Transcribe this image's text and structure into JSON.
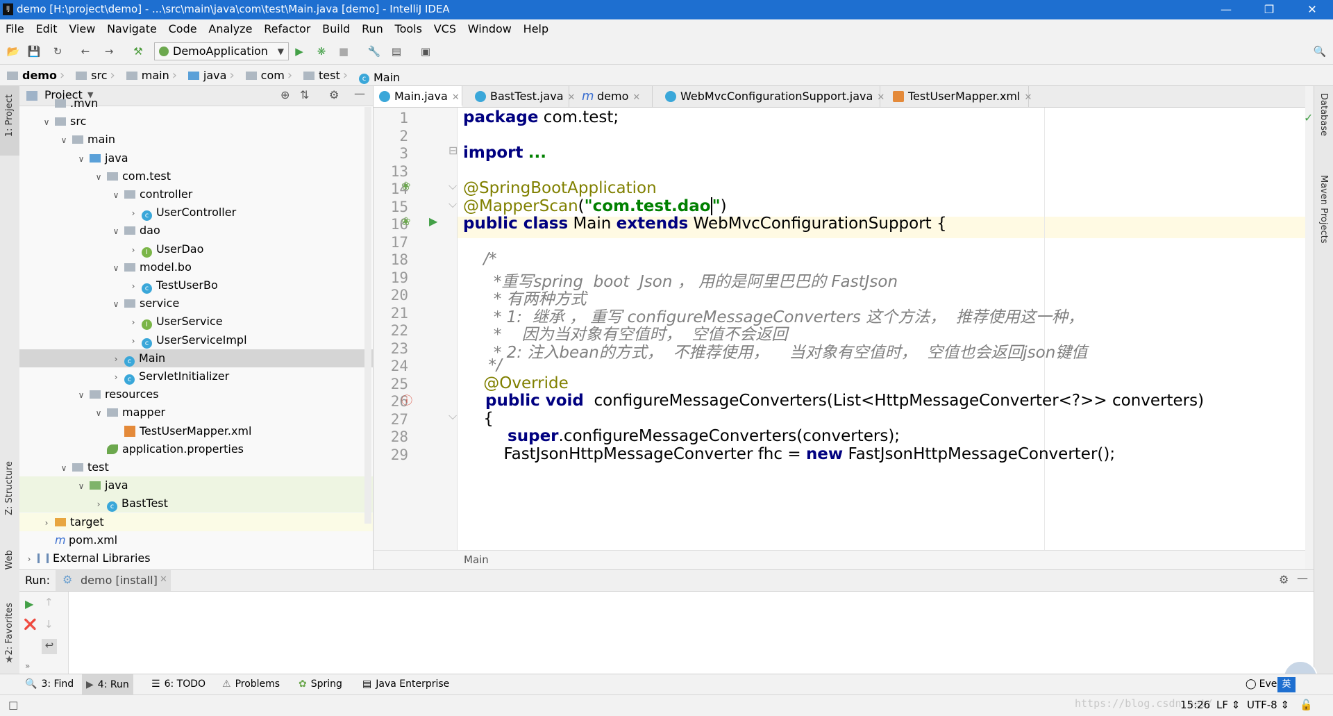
{
  "window": {
    "title": "demo [H:\\project\\demo] - ...\\src\\main\\java\\com\\test\\Main.java [demo] - IntelliJ IDEA",
    "app_icon": "IJ"
  },
  "menu": [
    "File",
    "Edit",
    "View",
    "Navigate",
    "Code",
    "Analyze",
    "Refactor",
    "Build",
    "Run",
    "Tools",
    "VCS",
    "Window",
    "Help"
  ],
  "toolbar": {
    "run_config": "DemoApplication"
  },
  "breadcrumb": [
    "demo",
    "src",
    "main",
    "java",
    "com",
    "test",
    "Main"
  ],
  "left_stripe": {
    "project": "1: Project",
    "structure": "Z: Structure",
    "web": "Web",
    "favorites": "2: Favorites"
  },
  "right_stripe": {
    "database": "Database",
    "maven": "Maven Projects"
  },
  "project_panel": {
    "title": "Project",
    "tree": [
      {
        "label": ".mvn",
        "indent": 1,
        "icon": "folder",
        "arrow": ""
      },
      {
        "label": "src",
        "indent": 1,
        "icon": "folder",
        "arrow": "down"
      },
      {
        "label": "main",
        "indent": 2,
        "icon": "folder",
        "arrow": "down"
      },
      {
        "label": "java",
        "indent": 3,
        "icon": "folder-blue",
        "arrow": "down"
      },
      {
        "label": "com.test",
        "indent": 4,
        "icon": "folder",
        "arrow": "down"
      },
      {
        "label": "controller",
        "indent": 5,
        "icon": "folder",
        "arrow": "down"
      },
      {
        "label": "UserController",
        "indent": 6,
        "icon": "class",
        "arrow": "right"
      },
      {
        "label": "dao",
        "indent": 5,
        "icon": "folder",
        "arrow": "down"
      },
      {
        "label": "UserDao",
        "indent": 6,
        "icon": "interface",
        "arrow": "right"
      },
      {
        "label": "model.bo",
        "indent": 5,
        "icon": "folder",
        "arrow": "down"
      },
      {
        "label": "TestUserBo",
        "indent": 6,
        "icon": "class",
        "arrow": "right"
      },
      {
        "label": "service",
        "indent": 5,
        "icon": "folder",
        "arrow": "down"
      },
      {
        "label": "UserService",
        "indent": 6,
        "icon": "interface",
        "arrow": "right"
      },
      {
        "label": "UserServiceImpl",
        "indent": 6,
        "icon": "class",
        "arrow": "right"
      },
      {
        "label": "Main",
        "indent": 5,
        "icon": "class",
        "arrow": "right",
        "selected": true
      },
      {
        "label": "ServletInitializer",
        "indent": 5,
        "icon": "class",
        "arrow": "right"
      },
      {
        "label": "resources",
        "indent": 3,
        "icon": "folder",
        "arrow": "down"
      },
      {
        "label": "mapper",
        "indent": 4,
        "icon": "folder",
        "arrow": "down"
      },
      {
        "label": "TestUserMapper.xml",
        "indent": 5,
        "icon": "xml",
        "arrow": ""
      },
      {
        "label": "application.properties",
        "indent": 4,
        "icon": "leaf",
        "arrow": ""
      },
      {
        "label": "test",
        "indent": 2,
        "icon": "folder",
        "arrow": "down"
      },
      {
        "label": "java",
        "indent": 3,
        "icon": "folder-green",
        "arrow": "down",
        "green": true
      },
      {
        "label": "BastTest",
        "indent": 4,
        "icon": "class",
        "arrow": "right",
        "green": true
      },
      {
        "label": "target",
        "indent": 1,
        "icon": "folder-orange",
        "arrow": "right",
        "yellow": true
      },
      {
        "label": "pom.xml",
        "indent": 1,
        "icon": "maven",
        "arrow": ""
      },
      {
        "label": "External Libraries",
        "indent": 0,
        "icon": "lib",
        "arrow": "right"
      }
    ]
  },
  "editor_tabs": [
    {
      "label": "Main.java",
      "active": true
    },
    {
      "label": "BastTest.java",
      "active": false
    },
    {
      "label": "demo",
      "active": false
    },
    {
      "label": "WebMvcConfigurationSupport.java",
      "active": false
    },
    {
      "label": "TestUserMapper.xml",
      "active": false
    }
  ],
  "code_lines": [
    {
      "n": "1",
      "parts": [
        [
          "kw",
          "package"
        ],
        [
          "t",
          " com.test;"
        ]
      ]
    },
    {
      "n": "2",
      "parts": []
    },
    {
      "n": "3",
      "parts": [
        [
          "kw",
          "import"
        ],
        [
          "t",
          " "
        ],
        [
          "str",
          "..."
        ]
      ]
    },
    {
      "n": "13",
      "parts": []
    },
    {
      "n": "14",
      "parts": [
        [
          "ann",
          "@SpringBootApplication"
        ]
      ]
    },
    {
      "n": "15",
      "parts": [
        [
          "ann",
          "@MapperScan"
        ],
        [
          "t",
          "("
        ],
        [
          "str",
          "\"com.test.dao"
        ],
        [
          "t",
          "|"
        ],
        [
          "str",
          "\""
        ],
        [
          "t",
          ")"
        ]
      ]
    },
    {
      "n": "16",
      "parts": [
        [
          "kw",
          "public class"
        ],
        [
          "t",
          " Main "
        ],
        [
          "kw",
          "extends"
        ],
        [
          "t",
          " WebMvcConfigurationSupport {"
        ]
      ]
    },
    {
      "n": "17",
      "parts": []
    },
    {
      "n": "18",
      "parts": [
        [
          "cm",
          "    /*"
        ]
      ]
    },
    {
      "n": "19",
      "parts": [
        [
          "cm",
          "      *重写spring  boot  Json ， 用的是阿里巴巴的 FastJson"
        ]
      ]
    },
    {
      "n": "20",
      "parts": [
        [
          "cm",
          "      * 有两种方式"
        ]
      ]
    },
    {
      "n": "21",
      "parts": [
        [
          "cm",
          "      * 1:  继承 ， 重写 configureMessageConverters 这个方法，  推荐使用这一种，"
        ]
      ]
    },
    {
      "n": "22",
      "parts": [
        [
          "cm",
          "      *    因为当对象有空值时，  空值不会返回"
        ]
      ]
    },
    {
      "n": "23",
      "parts": [
        [
          "cm",
          "      * 2: 注入bean的方式，  不推荐使用，    当对象有空值时，  空值也会返回json键值"
        ]
      ]
    },
    {
      "n": "24",
      "parts": [
        [
          "cm",
          "     */"
        ]
      ]
    },
    {
      "n": "25",
      "parts": [
        [
          "ann",
          "    @Override"
        ]
      ]
    },
    {
      "n": "26",
      "parts": [
        [
          "kw",
          "    public void"
        ],
        [
          "t",
          "  configureMessageConverters(List<HttpMessageConverter<?>> converters)"
        ]
      ]
    },
    {
      "n": "27",
      "parts": [
        [
          "t",
          "    {"
        ]
      ]
    },
    {
      "n": "28",
      "parts": [
        [
          "kw",
          "        super"
        ],
        [
          "t",
          ".configureMessageConverters(converters);"
        ]
      ]
    },
    {
      "n": "29",
      "parts": [
        [
          "t",
          "        FastJsonHttpMessageConverter fhc = "
        ],
        [
          "kw",
          "new"
        ],
        [
          "t",
          " FastJsonHttpMessageConverter();"
        ]
      ]
    }
  ],
  "editor_footer": "Main",
  "run_panel": {
    "label": "Run:",
    "tab": "demo [install]"
  },
  "tool_windows": [
    {
      "label": "3: Find",
      "icon": "search-icon"
    },
    {
      "label": "4: Run",
      "icon": "run-icon",
      "active": true
    },
    {
      "label": "6: TODO",
      "icon": "todo-icon"
    },
    {
      "label": "Problems",
      "icon": "problems-icon"
    },
    {
      "label": "Spring",
      "icon": "spring-icon"
    },
    {
      "label": "Java Enterprise",
      "icon": "java-enterprise-icon"
    }
  ],
  "status": {
    "event_log": "Eve",
    "ime": "英",
    "position": "15:26",
    "line_sep": "LF",
    "encoding": "UTF-8",
    "watermark": "https://blog.csdn.net/"
  }
}
